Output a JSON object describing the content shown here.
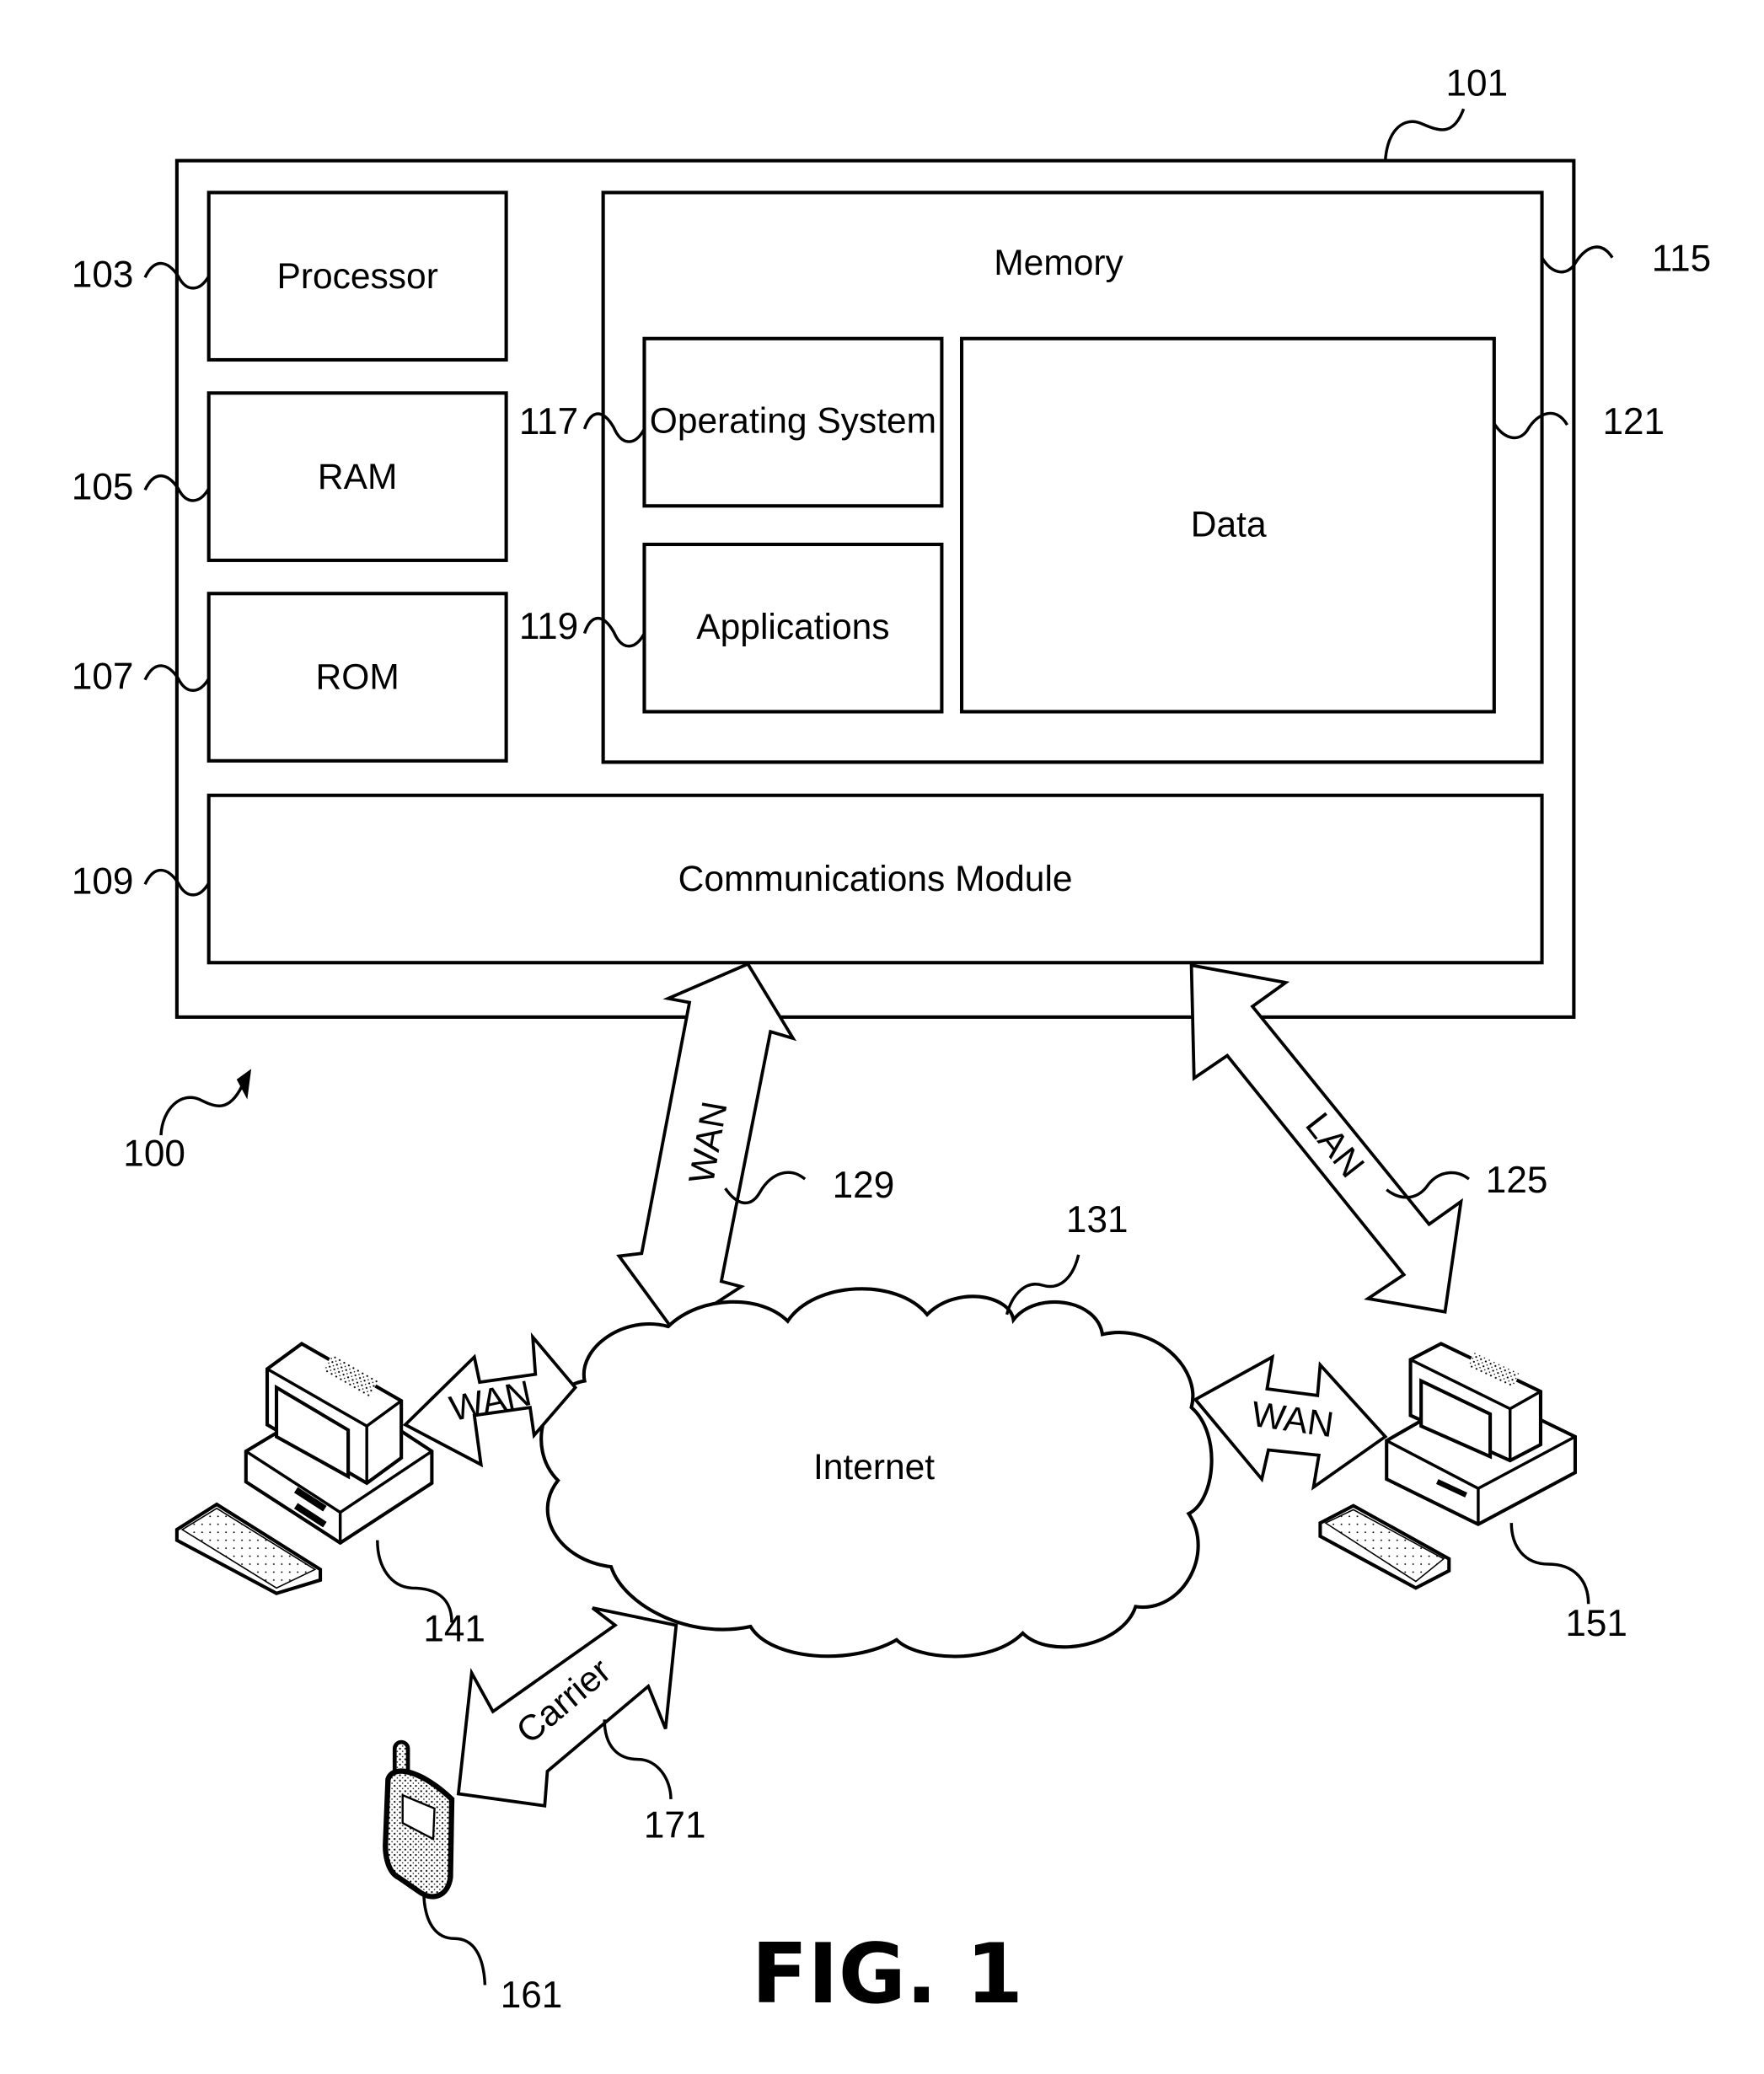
{
  "figure": {
    "caption": "FIG. 1",
    "system_ref": "100"
  },
  "device": {
    "ref": "101",
    "components": {
      "processor": {
        "label": "Processor",
        "ref": "103"
      },
      "ram": {
        "label": "RAM",
        "ref": "105"
      },
      "rom": {
        "label": "ROM",
        "ref": "107"
      },
      "comms": {
        "label": "Communications Module",
        "ref": "109"
      },
      "memory": {
        "label": "Memory",
        "ref": "115"
      },
      "os": {
        "label": "Operating System",
        "ref": "117"
      },
      "apps": {
        "label": "Applications",
        "ref": "119"
      },
      "data": {
        "label": "Data",
        "ref": "121"
      }
    }
  },
  "links": {
    "wan_main": {
      "label": "WAN",
      "ref": "129"
    },
    "lan": {
      "label": "LAN",
      "ref": "125"
    },
    "wan_left": {
      "label": "WAN"
    },
    "wan_right": {
      "label": "WAN"
    },
    "carrier": {
      "label": "Carrier",
      "ref": "171"
    }
  },
  "network": {
    "label": "Internet",
    "ref": "131"
  },
  "terminals": {
    "left_pc": {
      "ref": "141",
      "icon": "desktop-computer-icon"
    },
    "right_pc": {
      "ref": "151",
      "icon": "desktop-computer-icon"
    },
    "phone": {
      "ref": "161",
      "icon": "mobile-phone-icon"
    }
  }
}
